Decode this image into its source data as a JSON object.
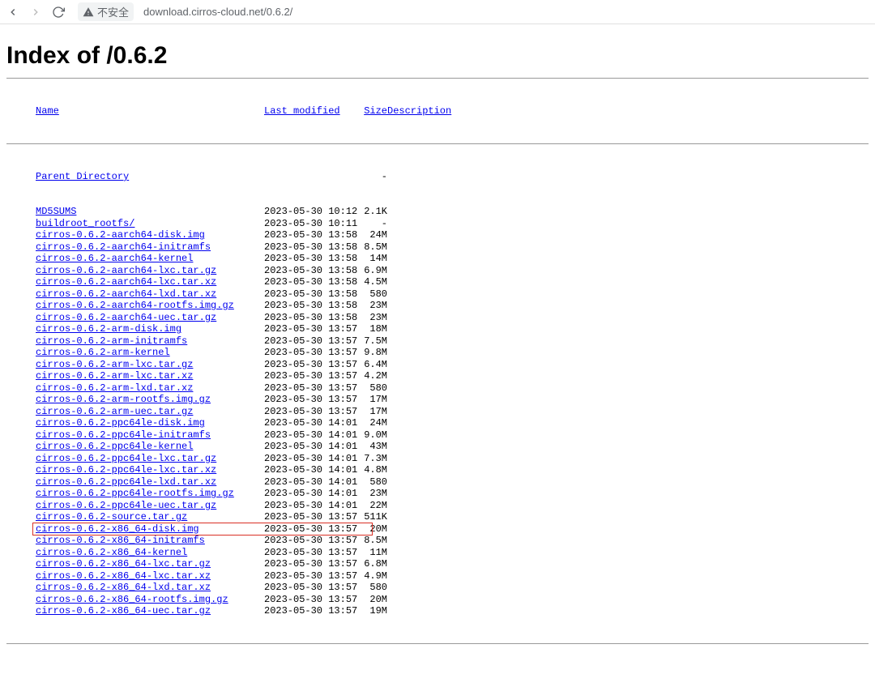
{
  "browser": {
    "security_text": "不安全",
    "url": "download.cirros-cloud.net/0.6.2/"
  },
  "page": {
    "heading": "Index of /0.6.2",
    "columns": {
      "name": "Name",
      "modified": "Last modified",
      "size": "Size",
      "description": "Description"
    },
    "parent_dir": "Parent Directory",
    "entries": [
      {
        "name": "MD5SUMS",
        "date": "2023-05-30 10:12",
        "size": "2.1K",
        "highlight": false
      },
      {
        "name": "buildroot_rootfs/",
        "date": "2023-05-30 10:11",
        "size": "-",
        "highlight": false
      },
      {
        "name": "cirros-0.6.2-aarch64-disk.img",
        "date": "2023-05-30 13:58",
        "size": "24M",
        "highlight": false
      },
      {
        "name": "cirros-0.6.2-aarch64-initramfs",
        "date": "2023-05-30 13:58",
        "size": "8.5M",
        "highlight": false
      },
      {
        "name": "cirros-0.6.2-aarch64-kernel",
        "date": "2023-05-30 13:58",
        "size": "14M",
        "highlight": false
      },
      {
        "name": "cirros-0.6.2-aarch64-lxc.tar.gz",
        "date": "2023-05-30 13:58",
        "size": "6.9M",
        "highlight": false
      },
      {
        "name": "cirros-0.6.2-aarch64-lxc.tar.xz",
        "date": "2023-05-30 13:58",
        "size": "4.5M",
        "highlight": false
      },
      {
        "name": "cirros-0.6.2-aarch64-lxd.tar.xz",
        "date": "2023-05-30 13:58",
        "size": "580",
        "highlight": false
      },
      {
        "name": "cirros-0.6.2-aarch64-rootfs.img.gz",
        "date": "2023-05-30 13:58",
        "size": "23M",
        "highlight": false
      },
      {
        "name": "cirros-0.6.2-aarch64-uec.tar.gz",
        "date": "2023-05-30 13:58",
        "size": "23M",
        "highlight": false
      },
      {
        "name": "cirros-0.6.2-arm-disk.img",
        "date": "2023-05-30 13:57",
        "size": "18M",
        "highlight": false
      },
      {
        "name": "cirros-0.6.2-arm-initramfs",
        "date": "2023-05-30 13:57",
        "size": "7.5M",
        "highlight": false
      },
      {
        "name": "cirros-0.6.2-arm-kernel",
        "date": "2023-05-30 13:57",
        "size": "9.8M",
        "highlight": false
      },
      {
        "name": "cirros-0.6.2-arm-lxc.tar.gz",
        "date": "2023-05-30 13:57",
        "size": "6.4M",
        "highlight": false
      },
      {
        "name": "cirros-0.6.2-arm-lxc.tar.xz",
        "date": "2023-05-30 13:57",
        "size": "4.2M",
        "highlight": false
      },
      {
        "name": "cirros-0.6.2-arm-lxd.tar.xz",
        "date": "2023-05-30 13:57",
        "size": "580",
        "highlight": false
      },
      {
        "name": "cirros-0.6.2-arm-rootfs.img.gz",
        "date": "2023-05-30 13:57",
        "size": "17M",
        "highlight": false
      },
      {
        "name": "cirros-0.6.2-arm-uec.tar.gz",
        "date": "2023-05-30 13:57",
        "size": "17M",
        "highlight": false
      },
      {
        "name": "cirros-0.6.2-ppc64le-disk.img",
        "date": "2023-05-30 14:01",
        "size": "24M",
        "highlight": false
      },
      {
        "name": "cirros-0.6.2-ppc64le-initramfs",
        "date": "2023-05-30 14:01",
        "size": "9.0M",
        "highlight": false
      },
      {
        "name": "cirros-0.6.2-ppc64le-kernel",
        "date": "2023-05-30 14:01",
        "size": "43M",
        "highlight": false
      },
      {
        "name": "cirros-0.6.2-ppc64le-lxc.tar.gz",
        "date": "2023-05-30 14:01",
        "size": "7.3M",
        "highlight": false
      },
      {
        "name": "cirros-0.6.2-ppc64le-lxc.tar.xz",
        "date": "2023-05-30 14:01",
        "size": "4.8M",
        "highlight": false
      },
      {
        "name": "cirros-0.6.2-ppc64le-lxd.tar.xz",
        "date": "2023-05-30 14:01",
        "size": "580",
        "highlight": false
      },
      {
        "name": "cirros-0.6.2-ppc64le-rootfs.img.gz",
        "date": "2023-05-30 14:01",
        "size": "23M",
        "highlight": false
      },
      {
        "name": "cirros-0.6.2-ppc64le-uec.tar.gz",
        "date": "2023-05-30 14:01",
        "size": "22M",
        "highlight": false
      },
      {
        "name": "cirros-0.6.2-source.tar.gz",
        "date": "2023-05-30 13:57",
        "size": "511K",
        "highlight": false
      },
      {
        "name": "cirros-0.6.2-x86_64-disk.img",
        "date": "2023-05-30 13:57",
        "size": "20M",
        "highlight": true
      },
      {
        "name": "cirros-0.6.2-x86_64-initramfs",
        "date": "2023-05-30 13:57",
        "size": "8.5M",
        "highlight": false
      },
      {
        "name": "cirros-0.6.2-x86_64-kernel",
        "date": "2023-05-30 13:57",
        "size": "11M",
        "highlight": false
      },
      {
        "name": "cirros-0.6.2-x86_64-lxc.tar.gz",
        "date": "2023-05-30 13:57",
        "size": "6.8M",
        "highlight": false
      },
      {
        "name": "cirros-0.6.2-x86_64-lxc.tar.xz",
        "date": "2023-05-30 13:57",
        "size": "4.9M",
        "highlight": false
      },
      {
        "name": "cirros-0.6.2-x86_64-lxd.tar.xz",
        "date": "2023-05-30 13:57",
        "size": "580",
        "highlight": false
      },
      {
        "name": "cirros-0.6.2-x86_64-rootfs.img.gz",
        "date": "2023-05-30 13:57",
        "size": "20M",
        "highlight": false
      },
      {
        "name": "cirros-0.6.2-x86_64-uec.tar.gz",
        "date": "2023-05-30 13:57",
        "size": "19M",
        "highlight": false
      }
    ]
  }
}
